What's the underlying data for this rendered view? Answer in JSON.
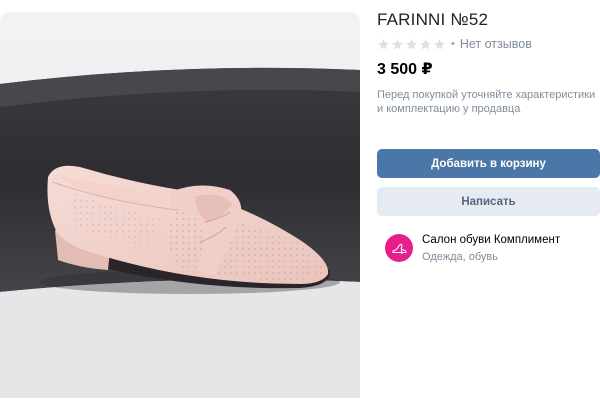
{
  "product": {
    "title": "FARINNI №52",
    "rating_stars": 0,
    "rating_max": 5,
    "reviews_label": "Нет отзывов",
    "price": "3 500 ₽",
    "note": "Перед покупкой уточняйте характеристики и комплектацию у продавца"
  },
  "actions": {
    "add_to_cart_label": "Добавить в корзину",
    "write_label": "Написать"
  },
  "seller": {
    "name": "Салон обуви Комплимент",
    "category": "Одежда, обувь"
  },
  "colors": {
    "primary_button": "#4a76a8",
    "secondary_button": "#e5ebf1",
    "secondary_text": "#818c99",
    "avatar_bg": "#e91e8c",
    "star_empty": "#dce1e6"
  },
  "icons": {
    "star": "star-outline-icon",
    "avatar": "shoe-logo-icon"
  }
}
